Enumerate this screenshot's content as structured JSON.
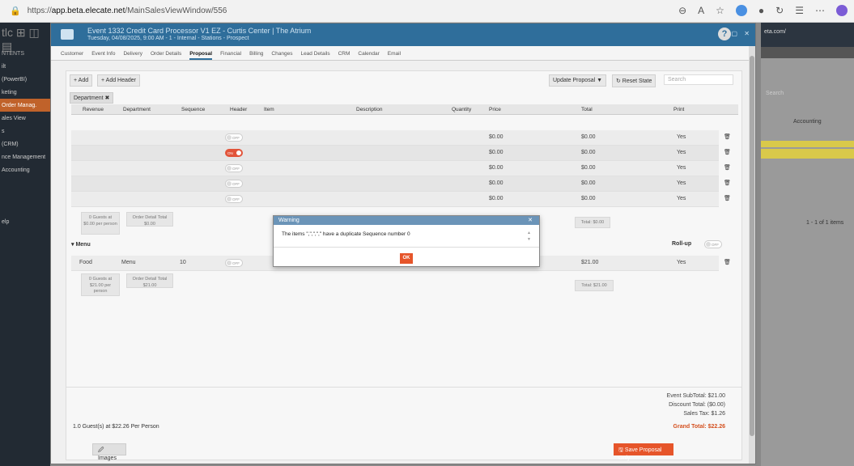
{
  "browser": {
    "url_prefix": "https://",
    "url_host": "app.beta.elecate.net",
    "url_path": "/MainSalesViewWindow/556"
  },
  "left_sidebar": {
    "logo": "tlc ⊞ ◫ ▤",
    "items": [
      "NTENTS",
      "ilt",
      "(PowerBI)",
      "keting",
      "Order Manag.",
      "ales View",
      "s",
      "(CRM)",
      "nce Management",
      "Accounting",
      "",
      "",
      "",
      "",
      "",
      "elp"
    ]
  },
  "right_bg": {
    "url_text": "eta.com/",
    "search_placeholder": "Search",
    "column": "Accounting",
    "pagination": "1 - 1 of 1 items"
  },
  "window": {
    "title": "Event 1332 Credit Card Processor V1 EZ - Curtis Center | The Atrium",
    "subtitle": "Tuesday, 04/08/2025, 9:00 AM - 1 - Internal - Stations - Prospect",
    "help": "?",
    "controls": "– ▢ ✕"
  },
  "tabs": [
    "Customer",
    "Event Info",
    "Delivery",
    "Order Details",
    "Proposal",
    "Financial",
    "Billing",
    "Changes",
    "Lead Details",
    "CRM",
    "Calendar",
    "Email"
  ],
  "active_tab": "Proposal",
  "toolbar": {
    "add": "+ Add",
    "add_header": "+ Add Header",
    "update_proposal": "Update Proposal ▼",
    "reset_state": "↻ Reset State",
    "search_placeholder": "Search"
  },
  "filter_chip": "Department ✖",
  "columns": [
    "Revenue",
    "Department",
    "Sequence",
    "Header",
    "Item",
    "Description",
    "Quantity",
    "Price",
    "Total",
    "Print"
  ],
  "rows": [
    {
      "price": "$0.00",
      "total": "$0.00",
      "print": "Yes",
      "header": "OFF",
      "on": false
    },
    {
      "price": "$0.00",
      "total": "$0.00",
      "print": "Yes",
      "header": "ON",
      "on": true
    },
    {
      "price": "$0.00",
      "total": "$0.00",
      "print": "Yes",
      "header": "OFF",
      "on": false
    },
    {
      "price": "$0.00",
      "total": "$0.00",
      "print": "Yes",
      "header": "OFF",
      "on": false
    },
    {
      "price": "$0.00",
      "total": "$0.00",
      "print": "Yes",
      "header": "OFF",
      "on": false
    }
  ],
  "group1_summary": {
    "guests": "0 Guests at $0.00 per person",
    "order_total": "Order Detail Total $0.00",
    "total": "Total: $0.00"
  },
  "menu_group": {
    "label": "▾ Menu",
    "rollup": "Roll-up",
    "rollup_state": "OFF"
  },
  "menu_row": {
    "revenue": "Food",
    "department": "Menu",
    "sequence": "10",
    "header": "OFF",
    "total": "$21.00",
    "print": "Yes"
  },
  "group2_summary": {
    "guests": "0 Guests at $21.00 per person",
    "order_total": "Order Detail Total $21.00",
    "total": "Total: $21.00"
  },
  "footer": {
    "guest_line": "1.0 Guest(s) at $22.26 Per Person",
    "images": "🖉 Images",
    "save": "🖫 Save Proposal Only",
    "event_subtotal": "Event SubTotal: $21.00",
    "discount": "Discount Total: ($0.00)",
    "sales_tax": "Sales Tax: $1.26",
    "grand_total": "Grand Total: $22.26"
  },
  "dialog": {
    "title": "Warning",
    "close": "✕",
    "message": "The items \",\",\",\",\" have a duplicate Sequence number 0",
    "ok": "OK"
  },
  "colors": {
    "header_blue": "#2f6e9b",
    "accent_orange": "#e6552a",
    "dialog_head": "#6b94b8"
  }
}
